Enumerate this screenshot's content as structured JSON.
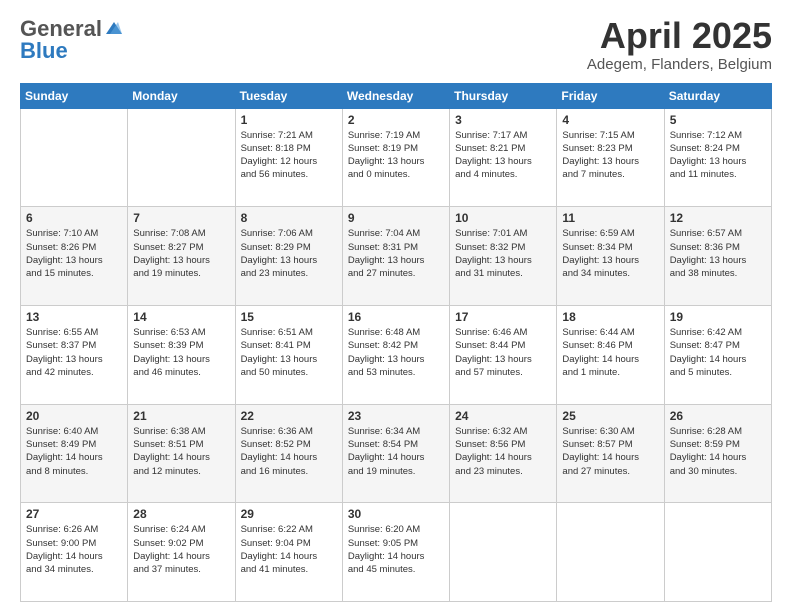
{
  "logo": {
    "general": "General",
    "blue": "Blue"
  },
  "header": {
    "month": "April 2025",
    "location": "Adegem, Flanders, Belgium"
  },
  "weekdays": [
    "Sunday",
    "Monday",
    "Tuesday",
    "Wednesday",
    "Thursday",
    "Friday",
    "Saturday"
  ],
  "weeks": [
    [
      {
        "day": "",
        "detail": ""
      },
      {
        "day": "",
        "detail": ""
      },
      {
        "day": "1",
        "detail": "Sunrise: 7:21 AM\nSunset: 8:18 PM\nDaylight: 12 hours\nand 56 minutes."
      },
      {
        "day": "2",
        "detail": "Sunrise: 7:19 AM\nSunset: 8:19 PM\nDaylight: 13 hours\nand 0 minutes."
      },
      {
        "day": "3",
        "detail": "Sunrise: 7:17 AM\nSunset: 8:21 PM\nDaylight: 13 hours\nand 4 minutes."
      },
      {
        "day": "4",
        "detail": "Sunrise: 7:15 AM\nSunset: 8:23 PM\nDaylight: 13 hours\nand 7 minutes."
      },
      {
        "day": "5",
        "detail": "Sunrise: 7:12 AM\nSunset: 8:24 PM\nDaylight: 13 hours\nand 11 minutes."
      }
    ],
    [
      {
        "day": "6",
        "detail": "Sunrise: 7:10 AM\nSunset: 8:26 PM\nDaylight: 13 hours\nand 15 minutes."
      },
      {
        "day": "7",
        "detail": "Sunrise: 7:08 AM\nSunset: 8:27 PM\nDaylight: 13 hours\nand 19 minutes."
      },
      {
        "day": "8",
        "detail": "Sunrise: 7:06 AM\nSunset: 8:29 PM\nDaylight: 13 hours\nand 23 minutes."
      },
      {
        "day": "9",
        "detail": "Sunrise: 7:04 AM\nSunset: 8:31 PM\nDaylight: 13 hours\nand 27 minutes."
      },
      {
        "day": "10",
        "detail": "Sunrise: 7:01 AM\nSunset: 8:32 PM\nDaylight: 13 hours\nand 31 minutes."
      },
      {
        "day": "11",
        "detail": "Sunrise: 6:59 AM\nSunset: 8:34 PM\nDaylight: 13 hours\nand 34 minutes."
      },
      {
        "day": "12",
        "detail": "Sunrise: 6:57 AM\nSunset: 8:36 PM\nDaylight: 13 hours\nand 38 minutes."
      }
    ],
    [
      {
        "day": "13",
        "detail": "Sunrise: 6:55 AM\nSunset: 8:37 PM\nDaylight: 13 hours\nand 42 minutes."
      },
      {
        "day": "14",
        "detail": "Sunrise: 6:53 AM\nSunset: 8:39 PM\nDaylight: 13 hours\nand 46 minutes."
      },
      {
        "day": "15",
        "detail": "Sunrise: 6:51 AM\nSunset: 8:41 PM\nDaylight: 13 hours\nand 50 minutes."
      },
      {
        "day": "16",
        "detail": "Sunrise: 6:48 AM\nSunset: 8:42 PM\nDaylight: 13 hours\nand 53 minutes."
      },
      {
        "day": "17",
        "detail": "Sunrise: 6:46 AM\nSunset: 8:44 PM\nDaylight: 13 hours\nand 57 minutes."
      },
      {
        "day": "18",
        "detail": "Sunrise: 6:44 AM\nSunset: 8:46 PM\nDaylight: 14 hours\nand 1 minute."
      },
      {
        "day": "19",
        "detail": "Sunrise: 6:42 AM\nSunset: 8:47 PM\nDaylight: 14 hours\nand 5 minutes."
      }
    ],
    [
      {
        "day": "20",
        "detail": "Sunrise: 6:40 AM\nSunset: 8:49 PM\nDaylight: 14 hours\nand 8 minutes."
      },
      {
        "day": "21",
        "detail": "Sunrise: 6:38 AM\nSunset: 8:51 PM\nDaylight: 14 hours\nand 12 minutes."
      },
      {
        "day": "22",
        "detail": "Sunrise: 6:36 AM\nSunset: 8:52 PM\nDaylight: 14 hours\nand 16 minutes."
      },
      {
        "day": "23",
        "detail": "Sunrise: 6:34 AM\nSunset: 8:54 PM\nDaylight: 14 hours\nand 19 minutes."
      },
      {
        "day": "24",
        "detail": "Sunrise: 6:32 AM\nSunset: 8:56 PM\nDaylight: 14 hours\nand 23 minutes."
      },
      {
        "day": "25",
        "detail": "Sunrise: 6:30 AM\nSunset: 8:57 PM\nDaylight: 14 hours\nand 27 minutes."
      },
      {
        "day": "26",
        "detail": "Sunrise: 6:28 AM\nSunset: 8:59 PM\nDaylight: 14 hours\nand 30 minutes."
      }
    ],
    [
      {
        "day": "27",
        "detail": "Sunrise: 6:26 AM\nSunset: 9:00 PM\nDaylight: 14 hours\nand 34 minutes."
      },
      {
        "day": "28",
        "detail": "Sunrise: 6:24 AM\nSunset: 9:02 PM\nDaylight: 14 hours\nand 37 minutes."
      },
      {
        "day": "29",
        "detail": "Sunrise: 6:22 AM\nSunset: 9:04 PM\nDaylight: 14 hours\nand 41 minutes."
      },
      {
        "day": "30",
        "detail": "Sunrise: 6:20 AM\nSunset: 9:05 PM\nDaylight: 14 hours\nand 45 minutes."
      },
      {
        "day": "",
        "detail": ""
      },
      {
        "day": "",
        "detail": ""
      },
      {
        "day": "",
        "detail": ""
      }
    ]
  ]
}
